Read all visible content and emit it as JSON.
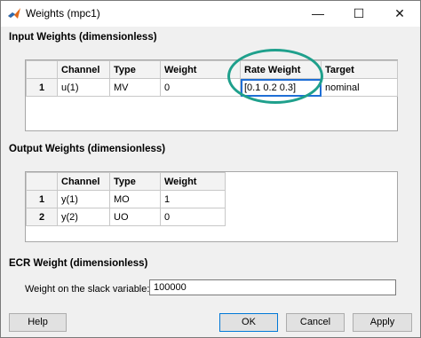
{
  "window": {
    "title": "Weights (mpc1)"
  },
  "input_weights": {
    "title": "Input Weights (dimensionless)",
    "columns": [
      "Channel",
      "Type",
      "Weight",
      "Rate Weight",
      "Target"
    ],
    "rows": [
      {
        "index": "1",
        "channel": "u(1)",
        "type": "MV",
        "weight": "0",
        "rate_weight": "[0.1 0.2 0.3]",
        "target": "nominal"
      }
    ]
  },
  "output_weights": {
    "title": "Output Weights (dimensionless)",
    "columns": [
      "Channel",
      "Type",
      "Weight"
    ],
    "rows": [
      {
        "index": "1",
        "channel": "y(1)",
        "type": "MO",
        "weight": "1"
      },
      {
        "index": "2",
        "channel": "y(2)",
        "type": "UO",
        "weight": "0"
      }
    ]
  },
  "ecr": {
    "title": "ECR Weight (dimensionless)",
    "label": "Weight on the slack variable:",
    "value": "100000"
  },
  "buttons": {
    "help": "Help",
    "ok": "OK",
    "cancel": "Cancel",
    "apply": "Apply"
  },
  "colors": {
    "annotation": "#1fa08c",
    "edit_focus": "#1f6fd6"
  }
}
